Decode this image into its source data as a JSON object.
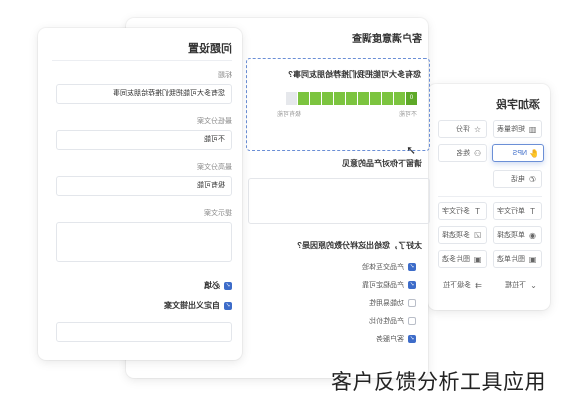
{
  "library": {
    "title": "添加字段",
    "items": [
      {
        "label": "矩阵量表",
        "icon": "matrix-icon",
        "glyph": "▥"
      },
      {
        "label": "评分",
        "icon": "star-icon",
        "glyph": "☆"
      },
      {
        "label": "NPS",
        "icon": "thumbs-up-icon",
        "glyph": "👍"
      },
      {
        "label": "姓名",
        "icon": "person-icon",
        "glyph": "⚇"
      },
      {
        "label": "电话",
        "icon": "phone-icon",
        "glyph": "✆"
      },
      {
        "label": "单行文字",
        "icon": "text-icon",
        "glyph": "T"
      },
      {
        "label": "多行文字",
        "icon": "multiline-icon",
        "glyph": "T"
      },
      {
        "label": "单项选择",
        "icon": "radio-icon",
        "glyph": "◉"
      },
      {
        "label": "多项选择",
        "icon": "checkbox-icon",
        "glyph": "☑"
      },
      {
        "label": "图片单选",
        "icon": "image-icon",
        "glyph": "▣"
      },
      {
        "label": "图片多选",
        "icon": "image-multi-icon",
        "glyph": "▣"
      },
      {
        "label": "下拉框",
        "icon": "dropdown-icon",
        "glyph": "⌄"
      },
      {
        "label": "多级下拉",
        "icon": "cascade-icon",
        "glyph": "⇉"
      }
    ]
  },
  "survey": {
    "title": "客户满意度调查",
    "q1": {
      "text": "您有多大可能把我们推荐给朋友同事?",
      "scale": [
        "0",
        "",
        "",
        "",
        "",
        "",
        "",
        "",
        "",
        "",
        "",
        ""
      ],
      "left_label": "不可能",
      "right_label": "极有可能"
    },
    "q2": {
      "text": "请留下你对产品的意见"
    },
    "q3": {
      "text": "太好了，您给出这样分数的原因是?",
      "options": [
        {
          "label": "产品交互体验",
          "checked": true
        },
        {
          "label": "产品稳定可靠",
          "checked": true
        },
        {
          "label": "功能易用性",
          "checked": false
        },
        {
          "label": "产品性价比",
          "checked": false
        },
        {
          "label": "客户服务",
          "checked": true
        }
      ]
    }
  },
  "settings": {
    "title": "问题设置",
    "title_label": "标题",
    "title_value": "您有多大可能把我们推荐给朋友同事",
    "min_label": "最低分文案",
    "min_value": "不可能",
    "max_label": "最高分文案",
    "max_value": "极有可能",
    "hint_label": "提示文案",
    "required_label": "必填",
    "custom_error_label": "自定义出错文案"
  },
  "caption": "客户反馈分析工具应用",
  "colors": {
    "accent": "#3d6cc9",
    "nps_green": "#7cc43f"
  }
}
